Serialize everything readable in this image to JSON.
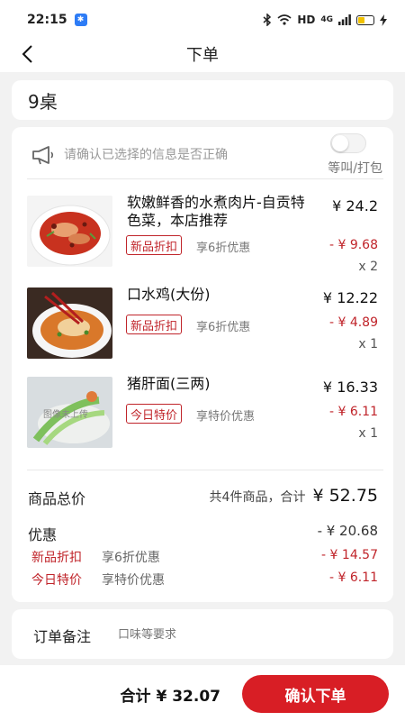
{
  "status_bar": {
    "time": "22:15",
    "network": "HD",
    "signal": "4G"
  },
  "nav": {
    "title": "下单"
  },
  "table": {
    "name": "9桌"
  },
  "notice": {
    "text": "请确认已选择的信息是否正确",
    "toggle_label": "等叫/打包",
    "toggle_on": false
  },
  "items": [
    {
      "name": "软嫩鲜香的水煮肉片-自贡特色菜，本店推荐",
      "price": "¥ 24.2",
      "tag": "新品折扣",
      "tag_desc": "享6折优惠",
      "discount": "- ¥ 9.68",
      "qty": "x 2",
      "image": "boiled-pork-image"
    },
    {
      "name": "口水鸡(大份)",
      "price": "¥ 12.22",
      "tag": "新品折扣",
      "tag_desc": "享6折优惠",
      "discount": "- ¥ 4.89",
      "qty": "x 1",
      "image": "chicken-image"
    },
    {
      "name": "猪肝面(三两)",
      "price": "¥ 16.33",
      "tag": "今日特价",
      "tag_desc": "享特价优惠",
      "discount": "- ¥ 6.11",
      "qty": "x 1",
      "image": "liver-noodle-image",
      "image_overlay": "图像未上传"
    }
  ],
  "summary": {
    "total_label": "商品总价",
    "count_text": "共4件商品，合计",
    "total_value": "¥ 52.75",
    "discount_label": "优惠",
    "discount_value": "- ¥ 20.68",
    "promos": [
      {
        "name": "新品折扣",
        "desc": "享6折优惠",
        "amount": "- ¥ 14.57"
      },
      {
        "name": "今日特价",
        "desc": "享特价优惠",
        "amount": "- ¥ 6.11"
      }
    ]
  },
  "remark": {
    "label": "订单备注",
    "placeholder": "口味等要求",
    "value": ""
  },
  "footer": {
    "total_text": "合计 ¥ 32.07",
    "submit_label": "确认下单"
  },
  "colors": {
    "accent": "#d81e25",
    "tag": "#c0242a"
  }
}
